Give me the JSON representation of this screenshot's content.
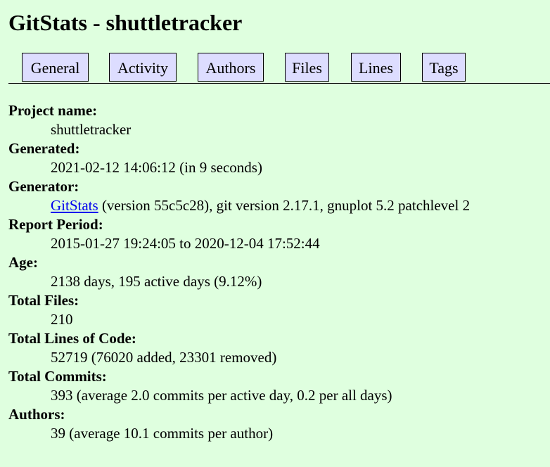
{
  "title": "GitStats - shuttletracker",
  "nav": [
    {
      "label": "General"
    },
    {
      "label": "Activity"
    },
    {
      "label": "Authors"
    },
    {
      "label": "Files"
    },
    {
      "label": "Lines"
    },
    {
      "label": "Tags"
    }
  ],
  "details": {
    "project_name": {
      "label": "Project name:",
      "value": "shuttletracker"
    },
    "generated": {
      "label": "Generated:",
      "value": "2021-02-12 14:06:12 (in 9 seconds)"
    },
    "generator": {
      "label": "Generator:",
      "link": "GitStats",
      "value": " (version 55c5c28), git version 2.17.1, gnuplot 5.2 patchlevel 2"
    },
    "report_period": {
      "label": "Report Period:",
      "value": "2015-01-27 19:24:05 to 2020-12-04 17:52:44"
    },
    "age": {
      "label": "Age:",
      "value": "2138 days, 195 active days (9.12%)"
    },
    "total_files": {
      "label": "Total Files:",
      "value": "210"
    },
    "total_lines": {
      "label": "Total Lines of Code:",
      "value": "52719 (76020 added, 23301 removed)"
    },
    "total_commits": {
      "label": "Total Commits:",
      "value": "393 (average 2.0 commits per active day, 0.2 per all days)"
    },
    "authors": {
      "label": "Authors:",
      "value": "39 (average 10.1 commits per author)"
    }
  }
}
